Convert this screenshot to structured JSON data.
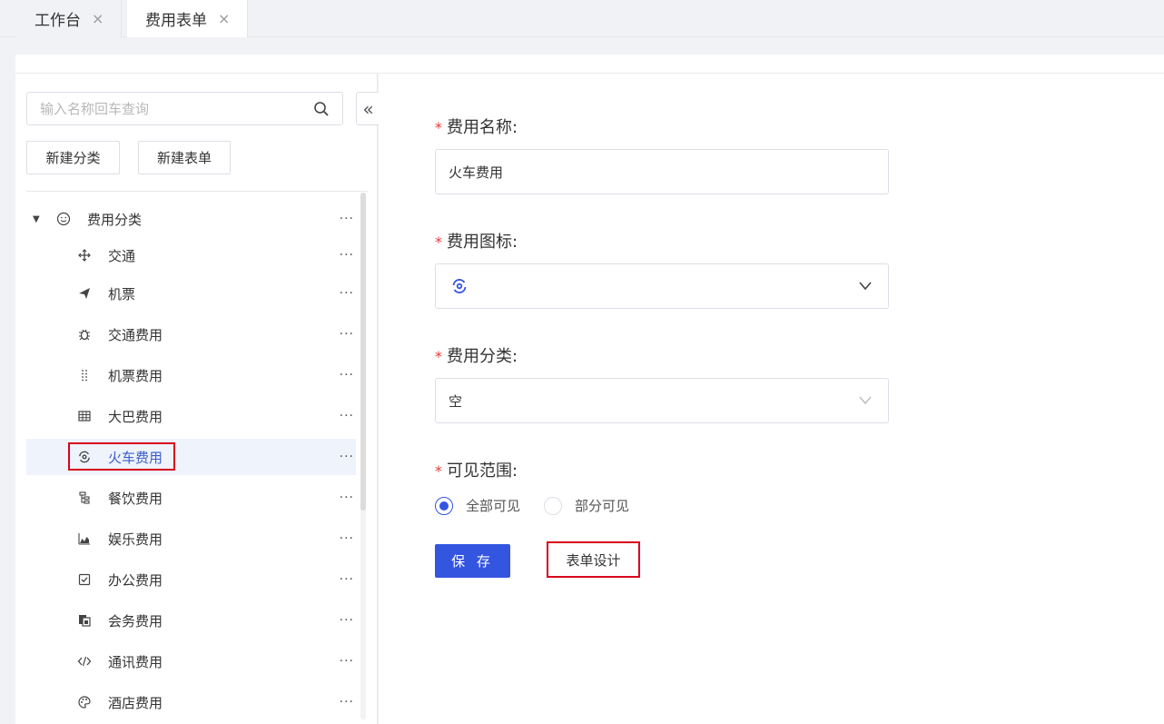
{
  "tabs": [
    {
      "label": "工作台",
      "close": "×"
    },
    {
      "label": "费用表单",
      "close": "×"
    }
  ],
  "sidebar": {
    "search_placeholder": "输入名称回车查询",
    "collapse_glyph": "«",
    "new_category_label": "新建分类",
    "new_form_label": "新建表单",
    "more_glyph": "···",
    "root": {
      "label": "费用分类",
      "icon": "smile-icon"
    },
    "items": [
      {
        "label": "交通",
        "icon": "move-icon"
      },
      {
        "label": "机票",
        "icon": "send-icon"
      },
      {
        "label": "交通费用",
        "icon": "bug-icon"
      },
      {
        "label": "机票费用",
        "icon": "drag-dots-icon"
      },
      {
        "label": "大巴费用",
        "icon": "table-icon"
      },
      {
        "label": "火车费用",
        "icon": "eye-swirl-icon"
      },
      {
        "label": "餐饮费用",
        "icon": "tree-structure-icon"
      },
      {
        "label": "娱乐费用",
        "icon": "area-chart-icon"
      },
      {
        "label": "办公费用",
        "icon": "checkbox-icon"
      },
      {
        "label": "会务费用",
        "icon": "copy-icon"
      },
      {
        "label": "通讯费用",
        "icon": "code-icon"
      },
      {
        "label": "酒店费用",
        "icon": "palette-icon"
      }
    ],
    "selected_index": 5
  },
  "form": {
    "name_label": "费用名称:",
    "name_value": "火车费用",
    "icon_label": "费用图标:",
    "icon_value": "eye-swirl-icon",
    "category_label": "费用分类:",
    "category_value": "空",
    "scope_label": "可见范围:",
    "scope_options": [
      "全部可见",
      "部分可见"
    ],
    "scope_selected": 0,
    "save_label": "保 存",
    "design_label": "表单设计",
    "required_mark": "*"
  },
  "colors": {
    "primary": "#3355e0",
    "highlight": "#d9001b",
    "required": "#e4393c",
    "selected_bg": "#eef3fc"
  }
}
